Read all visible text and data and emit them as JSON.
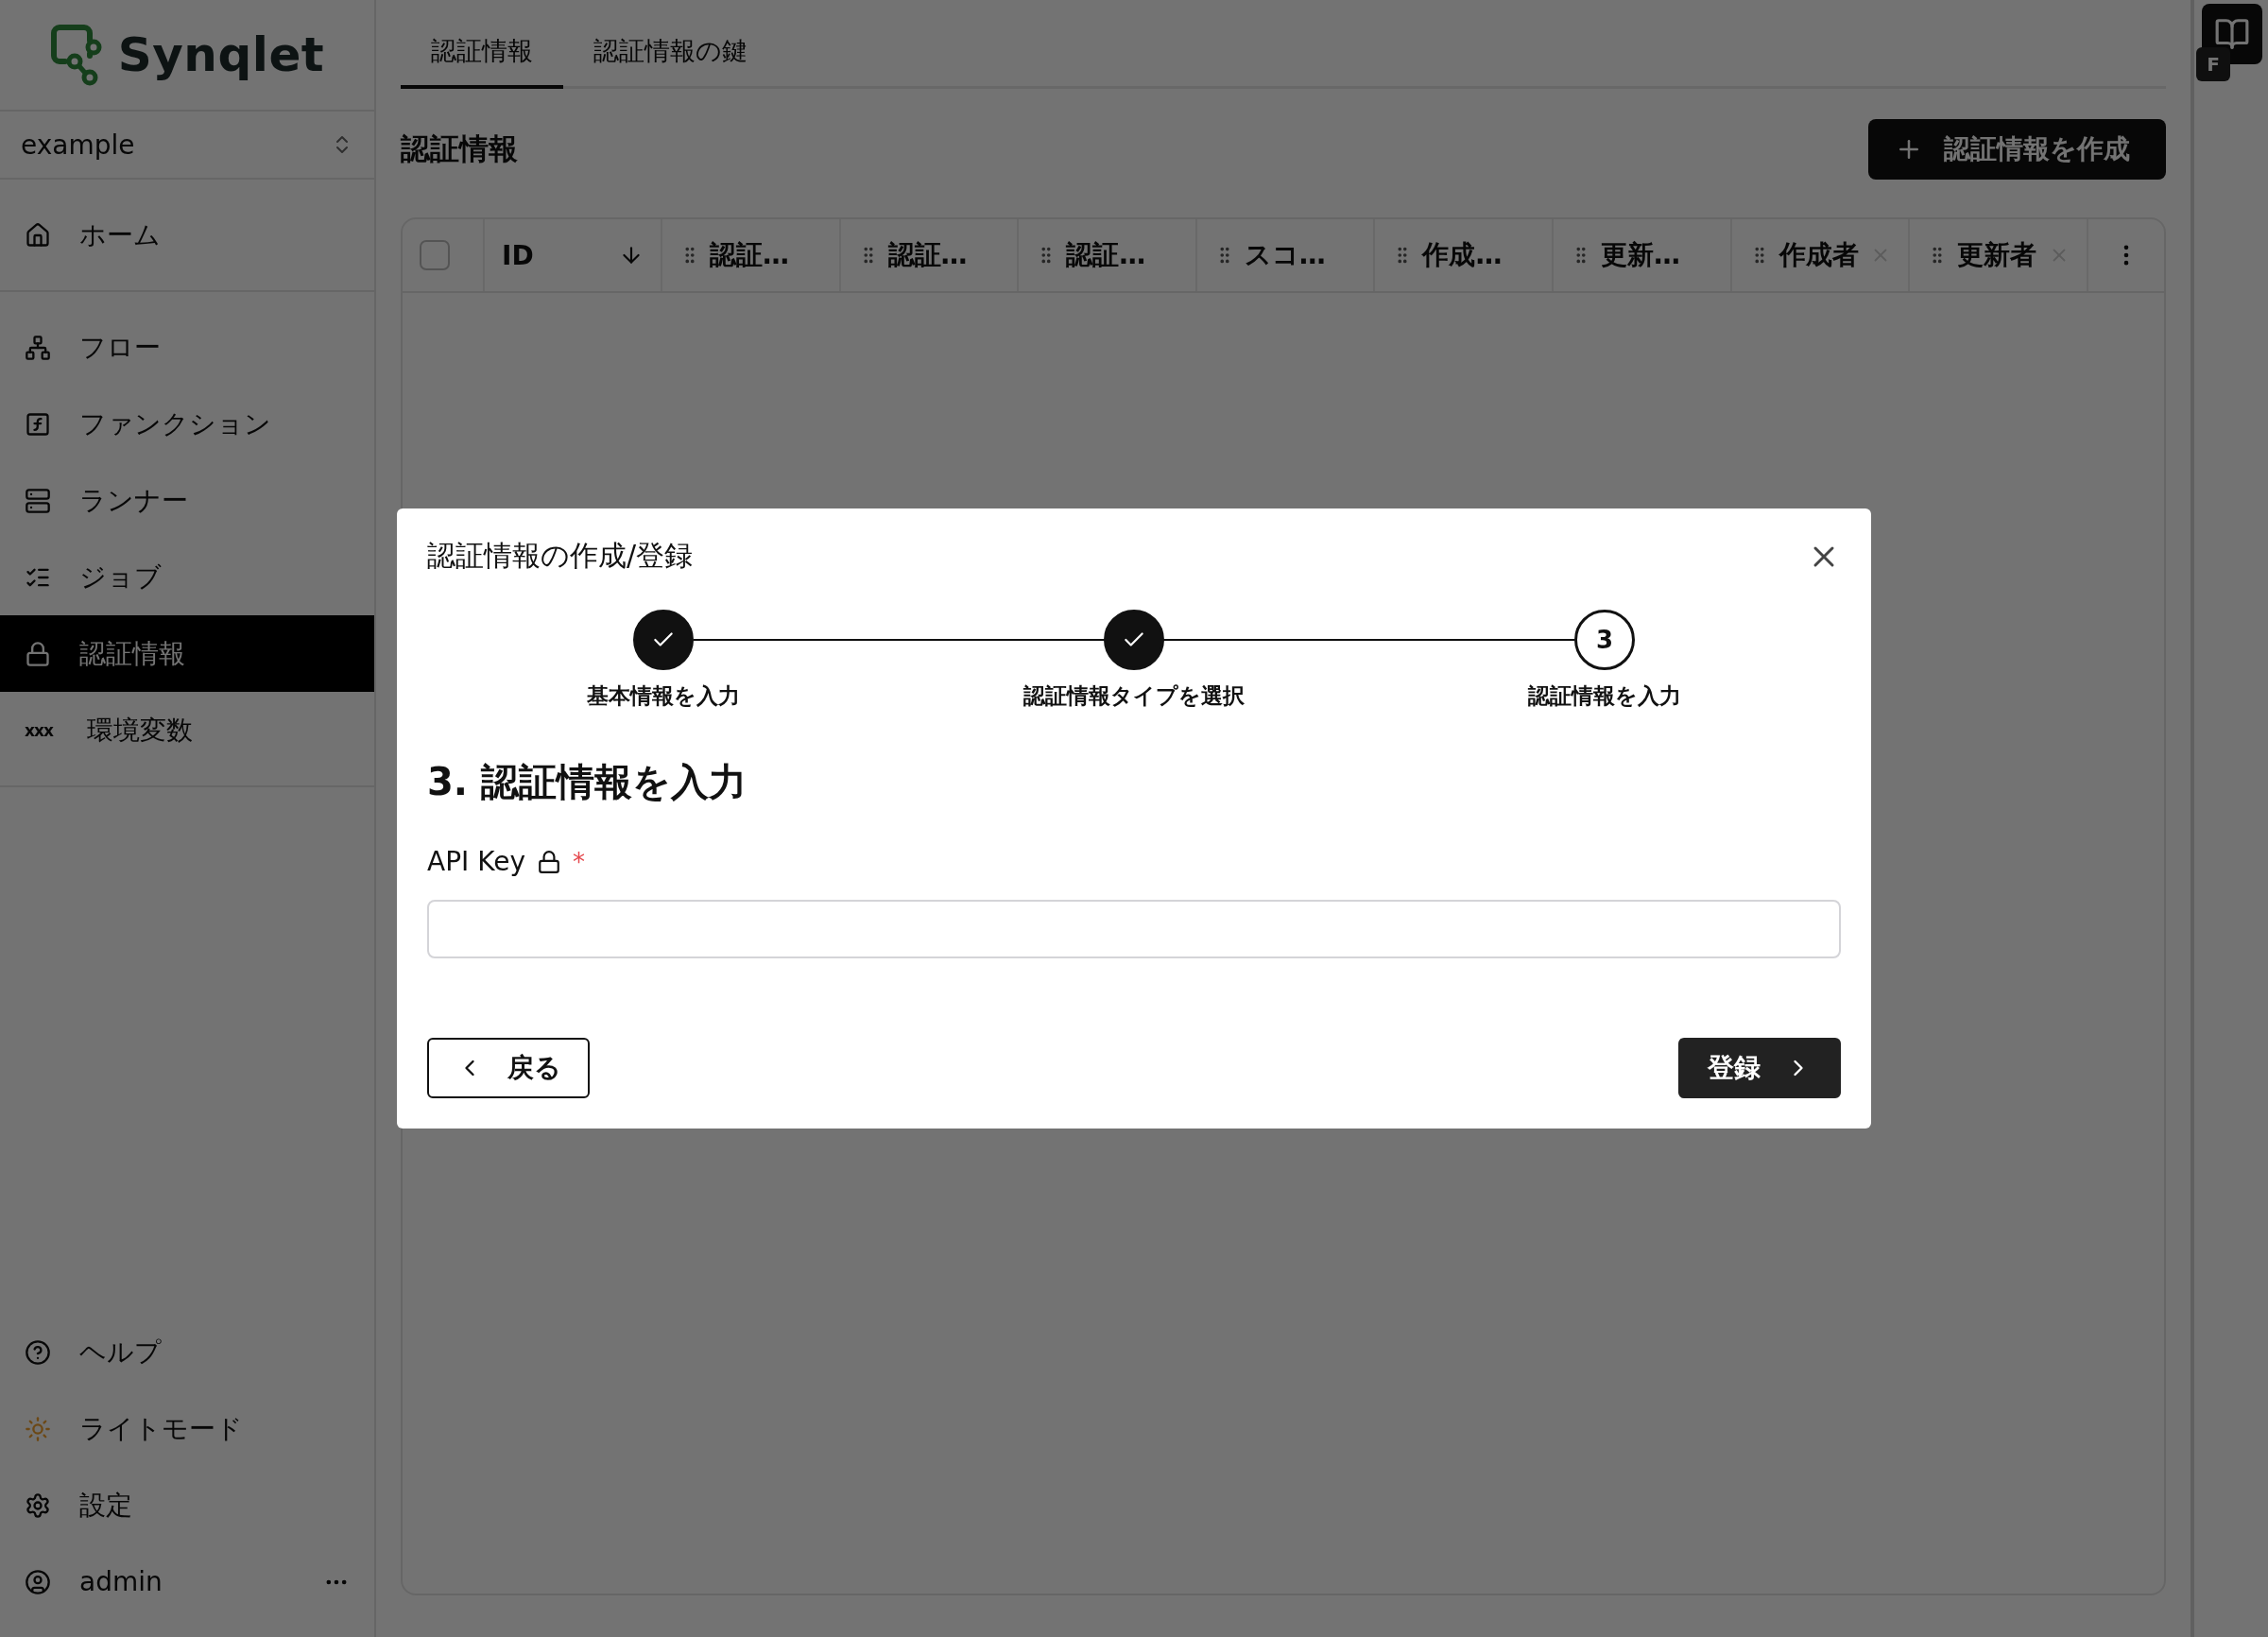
{
  "sidebar": {
    "logo": "Synqlet",
    "workspace": "example",
    "groups": [
      [
        {
          "label": "ホーム",
          "selected": false
        }
      ],
      [
        {
          "label": "フロー",
          "selected": false
        },
        {
          "label": "ファンクション",
          "selected": false
        },
        {
          "label": "ランナー",
          "selected": false
        },
        {
          "label": "ジョブ",
          "selected": false
        },
        {
          "label": "認証情報",
          "selected": true
        },
        {
          "label": "環境変数",
          "icon_text": "xxx",
          "selected": false
        }
      ]
    ],
    "bottom": [
      {
        "label": "ヘルプ"
      },
      {
        "label": "ライトモード"
      },
      {
        "label": "設定"
      },
      {
        "label": "admin",
        "menu": true
      }
    ]
  },
  "tabs": [
    {
      "label": "認証情報",
      "selected": true
    },
    {
      "label": "認証情報の鍵",
      "selected": false
    }
  ],
  "page_title": "認証情報",
  "create_button": "認証情報を作成",
  "table": {
    "select_all": false,
    "columns": [
      {
        "label": "ID"
      },
      {
        "label": "認証…",
        "draggable": true
      },
      {
        "label": "認証…",
        "draggable": true
      },
      {
        "label": "認証…",
        "draggable": true
      },
      {
        "label": "スコ…",
        "draggable": true
      },
      {
        "label": "作成…",
        "draggable": true
      },
      {
        "label": "更新…",
        "draggable": true
      },
      {
        "label": "作成者",
        "draggable": true,
        "removable": true
      },
      {
        "label": "更新者",
        "draggable": true,
        "removable": true
      }
    ]
  },
  "side_rail": {
    "badge": "F"
  },
  "dialog": {
    "title": "認証情報の作成/登録",
    "steps": [
      {
        "label": "基本情報を入力",
        "done": true
      },
      {
        "label": "認証情報タイプを選択",
        "done": true
      },
      {
        "label": "認証情報を入力",
        "number": "3",
        "done": false
      }
    ],
    "heading": "3. 認証情報を入力",
    "field": {
      "label": "API Key",
      "secret": true,
      "required": true,
      "required_mark": "*"
    },
    "back_button": "戻る",
    "submit_button": "登録"
  }
}
